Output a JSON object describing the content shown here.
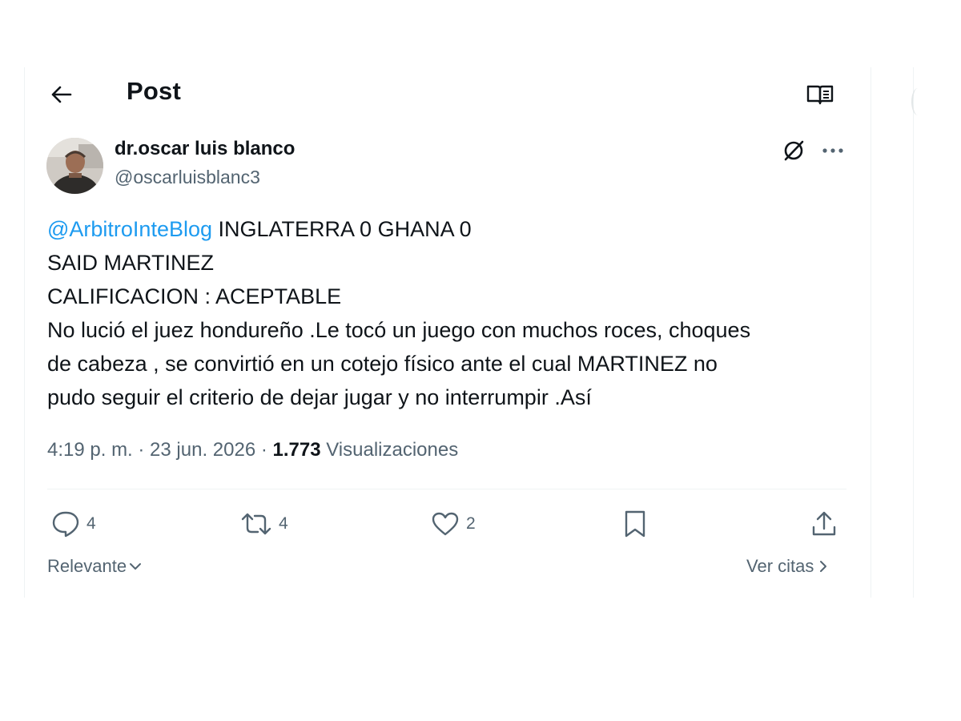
{
  "header": {
    "title": "Post",
    "back_icon": "arrow-left-icon",
    "reader_icon": "reader-mode-icon"
  },
  "post": {
    "author": {
      "name": "dr.oscar luis blanco",
      "handle": "@oscarluisblanc3"
    },
    "mention": "@ArbitroInteBlog",
    "line1_rest": " INGLATERRA 0 GHANA 0",
    "line2": "SAID MARTINEZ",
    "line3": "CALIFICACION : ACEPTABLE",
    "line4": "No lució el juez hondureño .Le tocó un juego con muchos roces, choques",
    "line5": "de cabeza , se convirtió en un cotejo físico ante el cual MARTINEZ no",
    "line6": "pudo seguir el criterio de dejar jugar y no interrumpir .Así",
    "timestamp": "4:19 p. m. · 23 jun. 2026 · ",
    "views_count": "1.773",
    "views_label": " Visualizaciones"
  },
  "actions": {
    "replies": "4",
    "reposts": "4",
    "likes": "2"
  },
  "footer": {
    "sort_label": "Relevante",
    "quotes_label": "Ver citas"
  },
  "colors": {
    "accent": "#1d9bf0",
    "text_primary": "#0f1419",
    "text_secondary": "#536471",
    "divider": "#eff3f4"
  }
}
